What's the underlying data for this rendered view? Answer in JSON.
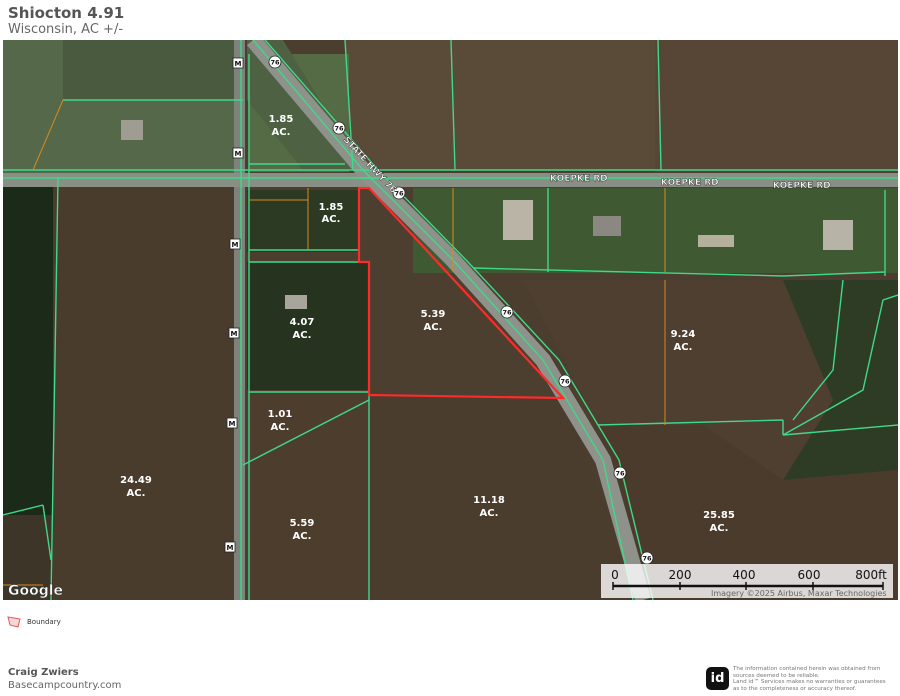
{
  "header": {
    "title": "Shiocton 4.91",
    "subtitle": "Wisconsin,  AC +/-"
  },
  "map": {
    "road_labels": {
      "hwy": "STATE HWY 76",
      "koepke": "KOEPKE RD"
    },
    "route_shields": {
      "hwy_number": "76",
      "county_letter": "M"
    },
    "parcels": [
      {
        "acres": "1.85",
        "unit": "AC."
      },
      {
        "acres": "1.85",
        "unit": "AC."
      },
      {
        "acres": "4.07",
        "unit": "AC."
      },
      {
        "acres": "5.39",
        "unit": "AC."
      },
      {
        "acres": "9.24",
        "unit": "AC."
      },
      {
        "acres": "1.01",
        "unit": "AC."
      },
      {
        "acres": "24.49",
        "unit": "AC."
      },
      {
        "acres": "11.18",
        "unit": "AC."
      },
      {
        "acres": "25.85",
        "unit": "AC."
      },
      {
        "acres": "5.59",
        "unit": "AC."
      }
    ],
    "google_logo": "Google",
    "scale": {
      "ticks": [
        "0",
        "200",
        "400",
        "600",
        "800ft"
      ]
    },
    "attribution": "Imagery ©2025 Airbus, Maxar Technologies"
  },
  "legend": {
    "label": "Boundary"
  },
  "footer": {
    "name": "Craig Zwiers",
    "website": "Basecampcountry.com",
    "logo_text": "id",
    "disclaimer": [
      "The information contained herein was obtained from",
      "sources deemed to be reliable.",
      "Land id™ Services makes no warranties or guarantees",
      "as to the completeness or accuracy thereof."
    ]
  },
  "colors": {
    "boundary": "#ff2a2a",
    "parcel_line": "#3fd98a",
    "lot_line": "#d98a1e",
    "road": "#8a8f86"
  }
}
